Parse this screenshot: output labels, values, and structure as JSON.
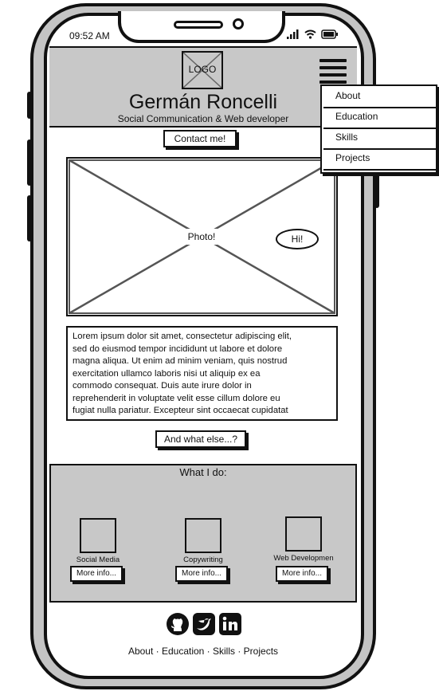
{
  "status": {
    "time": "09:52 AM"
  },
  "header": {
    "logo": "LOGO",
    "title": "Germán Roncelli",
    "subtitle": "Social Communication & Web developer",
    "contact_button": "Contact me!"
  },
  "photo": {
    "label": "Photo!",
    "bubble": "Hi!"
  },
  "about": {
    "lines": [
      "Lorem ipsum dolor sit amet, consectetur adipiscing elit,",
      "sed do eiusmod tempor incididunt ut labore et dolore",
      "magna aliqua. Ut enim ad minim veniam, quis nostrud",
      "exercitation ullamco laboris nisi ut aliquip ex ea",
      "commodo consequat. Duis aute irure dolor in",
      "reprehenderit in voluptate velit esse cillum dolore eu",
      "fugiat nulla pariatur. Excepteur sint occaecat cupidatat"
    ],
    "more_button": "And what else...?"
  },
  "what_i_do": {
    "title": "What I do:",
    "items": [
      {
        "label": "Social Media",
        "button": "More info..."
      },
      {
        "label": "Copywriting",
        "button": "More info..."
      },
      {
        "label": "Web Developmen",
        "button": "More info..."
      }
    ]
  },
  "social": {
    "icons": [
      "github-icon",
      "twitter-icon",
      "linkedin-icon"
    ]
  },
  "footer": {
    "links": "About · Education · Skills · Projects"
  },
  "menu": {
    "items": [
      "About",
      "Education",
      "Skills",
      "Projects"
    ]
  },
  "colors": {
    "panel": "#c8c8c8",
    "stroke": "#111111",
    "frame": "#c4c4c4"
  }
}
